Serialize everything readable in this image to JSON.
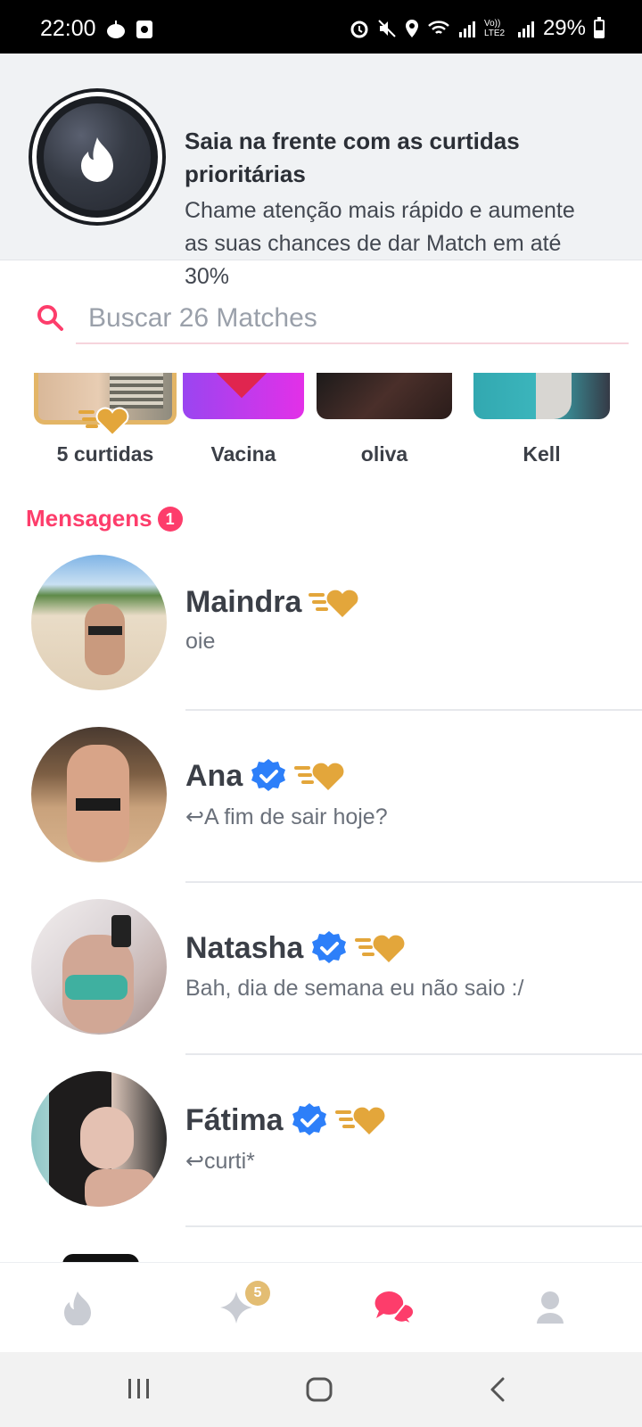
{
  "status": {
    "time": "22:00",
    "battery": "29%",
    "network": "Vo)) LTE2"
  },
  "promo": {
    "title": "Saia na frente com as curtidas prioritárias",
    "text": "Chame atenção mais rápido e aumente as suas chances de dar Match em até 30%"
  },
  "search": {
    "placeholder": "Buscar 26 Matches"
  },
  "matches": [
    {
      "name": "5 curtidas"
    },
    {
      "name": "Vacina"
    },
    {
      "name": "oliva"
    },
    {
      "name": "Kell"
    }
  ],
  "messages_section": {
    "title": "Mensagens",
    "count": "1"
  },
  "messages": [
    {
      "name": "Maindra",
      "preview": "oie",
      "verified": false
    },
    {
      "name": "Ana",
      "preview": "↩A fim de sair hoje?",
      "verified": true
    },
    {
      "name": "Natasha",
      "preview": "Bah, dia de semana eu não saio :/",
      "verified": true
    },
    {
      "name": "Fátima",
      "preview": "↩curti*",
      "verified": true
    }
  ],
  "nav": {
    "sparkle_badge": "5"
  },
  "colors": {
    "accent": "#fd3d6b",
    "gold": "#e3a63b",
    "verified": "#2d7ff9"
  }
}
